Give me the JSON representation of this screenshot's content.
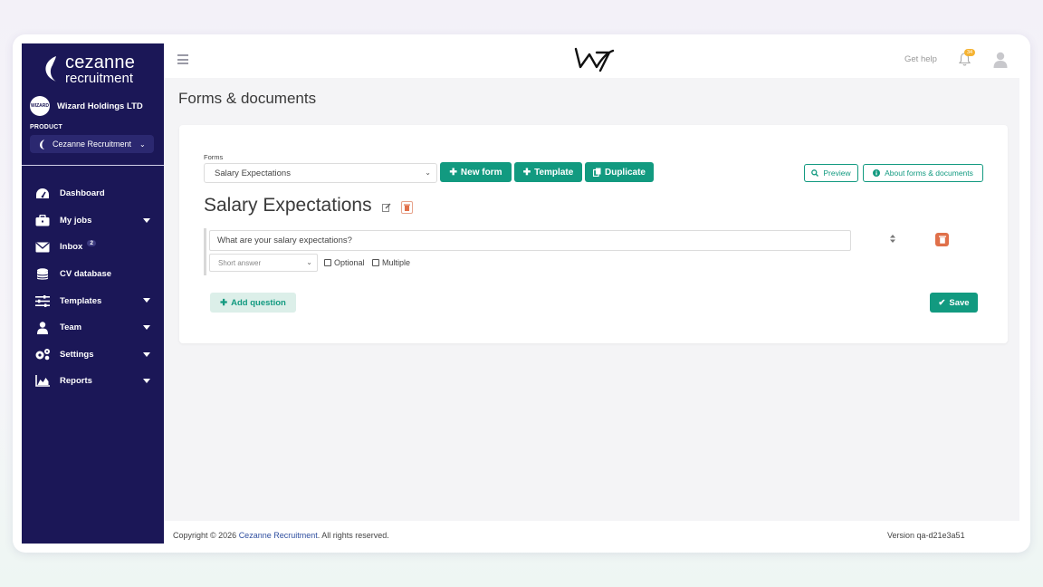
{
  "app": {
    "logo_line1": "cezanne",
    "logo_line2": "recruitment"
  },
  "sidebar": {
    "company_avatar": "WIZARD",
    "company_name": "Wizard Holdings LTD",
    "product_label": "PRODUCT",
    "product_value": "Cezanne Recruitment",
    "items": [
      {
        "label": "Dashboard",
        "icon": "dashboard-icon",
        "has_caret": false
      },
      {
        "label": "My jobs",
        "icon": "briefcase-icon",
        "has_caret": true
      },
      {
        "label": "Inbox",
        "icon": "envelope-icon",
        "has_caret": false,
        "badge": "2"
      },
      {
        "label": "CV database",
        "icon": "database-icon",
        "has_caret": false
      },
      {
        "label": "Templates",
        "icon": "sliders-icon",
        "has_caret": true
      },
      {
        "label": "Team",
        "icon": "team-icon",
        "has_caret": true
      },
      {
        "label": "Settings",
        "icon": "cogs-icon",
        "has_caret": true
      },
      {
        "label": "Reports",
        "icon": "chart-icon",
        "has_caret": true
      }
    ]
  },
  "topbar": {
    "get_help": "Get help",
    "notification_count": "34"
  },
  "page": {
    "title": "Forms & documents"
  },
  "form_editor": {
    "forms_label": "Forms",
    "selected_form": "Salary Expectations",
    "new_form_label": "New form",
    "template_label": "Template",
    "duplicate_label": "Duplicate",
    "preview_label": "Preview",
    "about_label": "About forms & documents",
    "form_title": "Salary Expectations",
    "question_text": "What are your salary expectations?",
    "answer_type": "Short answer",
    "optional_label": "Optional",
    "multiple_label": "Multiple",
    "add_question_label": "Add question",
    "save_label": "Save"
  },
  "footer": {
    "copyright_prefix": "Copyright © 2026 ",
    "copyright_link": "Cezanne Recruitment",
    "copyright_suffix": ". All rights reserved.",
    "version": "Version qa-d21e3a51"
  },
  "colors": {
    "sidebar_bg": "#1b1757",
    "accent": "#129a80",
    "danger": "#e0704a"
  }
}
